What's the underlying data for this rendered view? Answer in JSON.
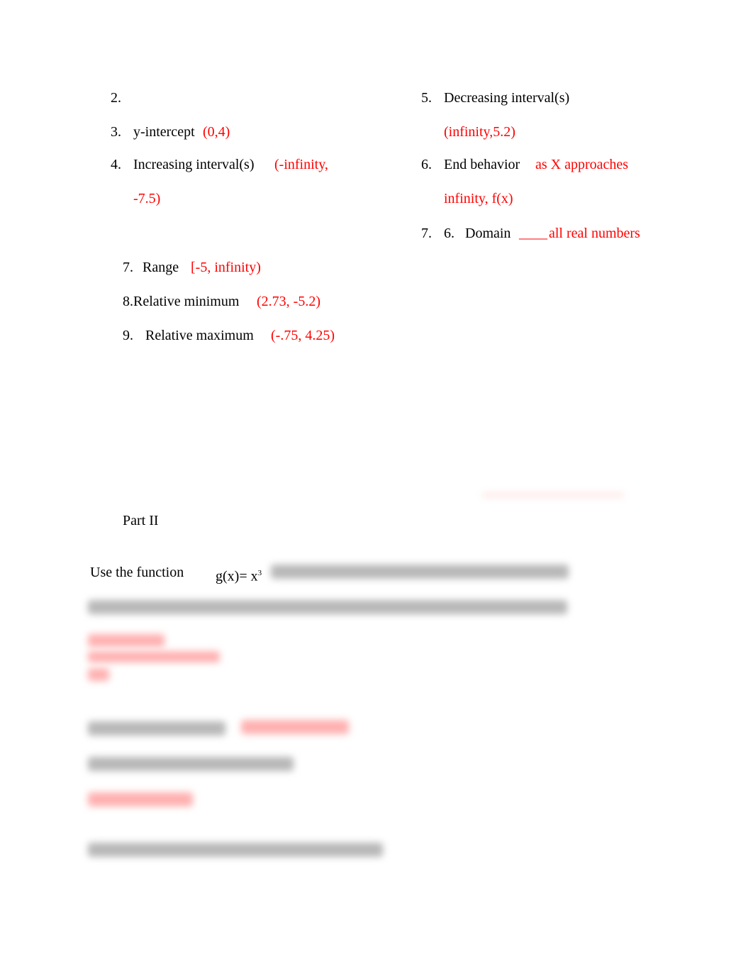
{
  "colors": {
    "answer": "#ff0000",
    "text": "#000000"
  },
  "left": {
    "q2": {
      "num": "2."
    },
    "q3": {
      "num": "3.",
      "label": "y-intercept",
      "answer": "(0,4)"
    },
    "q4": {
      "num": "4.",
      "label": "Increasing interval(s)",
      "answer1": "(-infinity,",
      "answer2": "-7.5)"
    },
    "q7": {
      "num": "7.",
      "label": "Range",
      "answer": "[-5, infinity)"
    },
    "q8": {
      "label": "8.Relative minimum",
      "answer": "(2.73, -5.2)"
    },
    "q9": {
      "num": "9.",
      "label": "Relative maximum",
      "answer": "(-.75, 4.25)"
    }
  },
  "right": {
    "q5": {
      "num": "5.",
      "label": "Decreasing interval(s)",
      "answer": "(infinity,5.2)"
    },
    "q6": {
      "num": "6.",
      "label": "End behavior",
      "answer1": "as X approaches",
      "answer2": "infinity, f(x)"
    },
    "q7": {
      "num": "7.",
      "sub": "6.",
      "label": "Domain",
      "blank": "____",
      "answer": "all real numbers"
    }
  },
  "part2": {
    "heading": "Part II",
    "intro": "Use the function",
    "func": "g(x)= x",
    "exp": "3"
  }
}
